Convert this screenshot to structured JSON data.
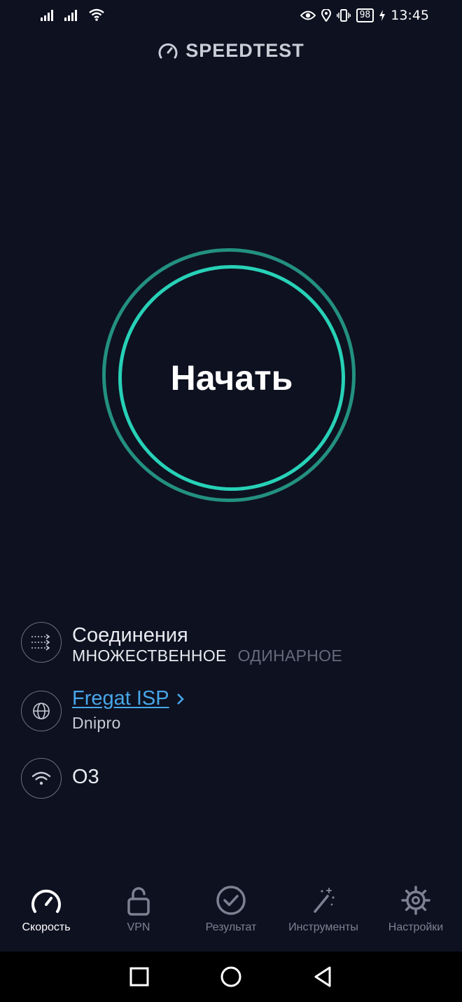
{
  "status_bar": {
    "battery": "98",
    "time": "13:45"
  },
  "header": {
    "title": "SPEEDTEST"
  },
  "go_button": {
    "label": "Начать"
  },
  "connections": {
    "title": "Соединения",
    "options": [
      "МНОЖЕСТВЕННОЕ",
      "ОДИНАРНОЕ"
    ],
    "selected": "МНОЖЕСТВЕННОЕ"
  },
  "provider": {
    "name": "Fregat ISP",
    "city": "Dnipro"
  },
  "network": {
    "name": "O3"
  },
  "nav": {
    "items": [
      {
        "label": "Скорость",
        "icon": "speedometer-icon"
      },
      {
        "label": "VPN",
        "icon": "lock-open-icon"
      },
      {
        "label": "Результат",
        "icon": "check-circle-icon"
      },
      {
        "label": "Инструменты",
        "icon": "magic-wand-icon"
      },
      {
        "label": "Настройки",
        "icon": "gear-icon"
      }
    ],
    "active_index": 0
  },
  "colors": {
    "background": "#0e1120",
    "ring_inner": "#27d1b7",
    "ring_outer": "#239080",
    "link": "#47a6e8",
    "inactive": "#7d8192"
  }
}
